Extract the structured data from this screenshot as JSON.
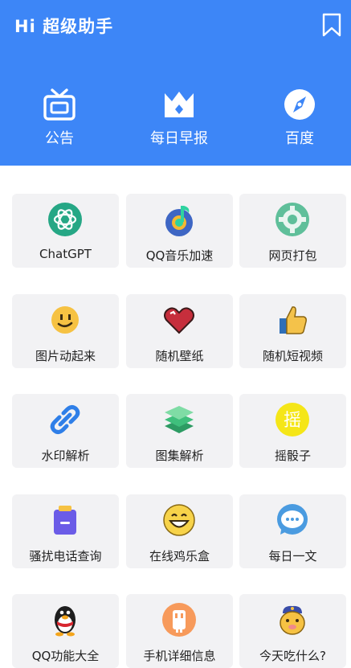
{
  "header": {
    "title": "Hi 超级助手",
    "bookmark_icon": "bookmark-icon",
    "quick_actions": [
      {
        "label": "公告",
        "icon": "announcement-icon"
      },
      {
        "label": "每日早报",
        "icon": "crown-icon"
      },
      {
        "label": "百度",
        "icon": "compass-icon"
      }
    ]
  },
  "colors": {
    "accent": "#3d86f7",
    "card_bg": "#f2f2f4"
  },
  "tools": [
    {
      "label": "ChatGPT",
      "icon": "openai-icon"
    },
    {
      "label": "QQ音乐加速",
      "icon": "music-note-icon"
    },
    {
      "label": "网页打包",
      "icon": "gear-icon"
    },
    {
      "label": "图片动起来",
      "icon": "smile-icon"
    },
    {
      "label": "随机壁纸",
      "icon": "heart-icon"
    },
    {
      "label": "随机短视频",
      "icon": "thumbs-up-icon"
    },
    {
      "label": "水印解析",
      "icon": "link-icon"
    },
    {
      "label": "图集解析",
      "icon": "layers-icon"
    },
    {
      "label": "摇骰子",
      "icon": "shake-badge-icon",
      "badge_text": "摇"
    },
    {
      "label": "骚扰电话查询",
      "icon": "phone-block-icon"
    },
    {
      "label": "在线鸡乐盒",
      "icon": "grin-face-icon"
    },
    {
      "label": "每日一文",
      "icon": "chat-bubble-icon"
    },
    {
      "label": "QQ功能大全",
      "icon": "qq-penguin-icon"
    },
    {
      "label": "手机详细信息",
      "icon": "phone-info-icon"
    },
    {
      "label": "今天吃什么?",
      "icon": "chef-face-icon"
    }
  ]
}
